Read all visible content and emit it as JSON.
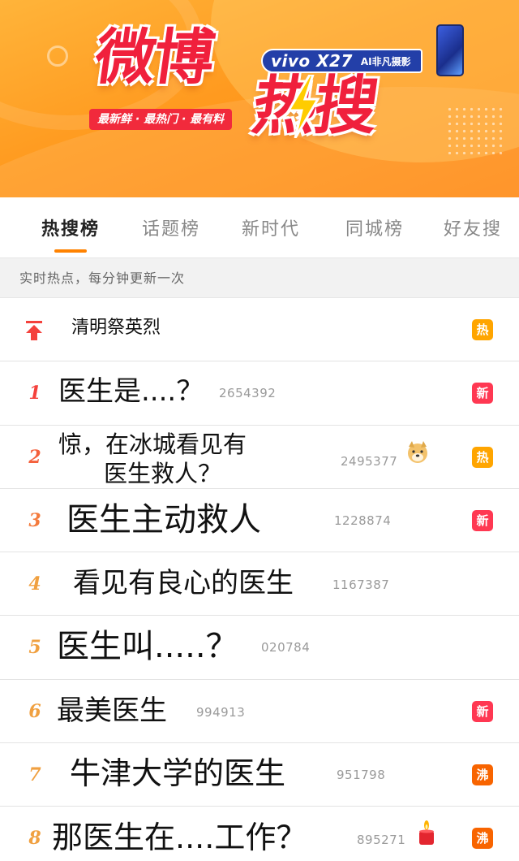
{
  "banner": {
    "title_part1": "微博",
    "title_part2": "热搜",
    "tagline": "最新鲜 · 最热门 · 最有料",
    "sponsor_brand": "vivo X27",
    "sponsor_sub": "AI非凡摄影",
    "accent_red": "#f0203c",
    "background_orange": "#ff9a1f"
  },
  "tabs": [
    {
      "label": "热搜榜",
      "active": true
    },
    {
      "label": "话题榜",
      "active": false
    },
    {
      "label": "新时代",
      "active": false
    },
    {
      "label": "同城榜",
      "active": false
    },
    {
      "label": "好友搜",
      "active": false
    }
  ],
  "subheader": "实时热点，每分钟更新一次",
  "pinned": {
    "title": "清明祭英烈",
    "badge": "热",
    "icon": "arrow-up-pin-icon"
  },
  "items": [
    {
      "rank": "1",
      "title": "医生是....？",
      "count": "2654392",
      "badge": "新"
    },
    {
      "rank": "2",
      "title_line1": "惊，在冰城看见有",
      "title_line2": "医生救人？",
      "count": "2495377",
      "emoji": "doge-emoji-icon",
      "badge": "热"
    },
    {
      "rank": "3",
      "title": "医生主动救人",
      "count": "1228874",
      "badge": "新"
    },
    {
      "rank": "4",
      "title": "看见有良心的医生",
      "count": "1167387",
      "badge": ""
    },
    {
      "rank": "5",
      "title": "医生叫.....？",
      "count": "020784",
      "badge": ""
    },
    {
      "rank": "6",
      "title": "最美医生",
      "count": "994913",
      "badge": "新"
    },
    {
      "rank": "7",
      "title": "牛津大学的医生",
      "count": "951798",
      "badge": "沸"
    },
    {
      "rank": "8",
      "title": "那医生在....工作？",
      "count": "895271",
      "emoji": "candle-emoji-icon",
      "badge": "沸"
    }
  ],
  "colors": {
    "hot": "#ffa500",
    "new": "#ff3852",
    "boil": "#f86400",
    "tab_underline": "#ff8200"
  }
}
